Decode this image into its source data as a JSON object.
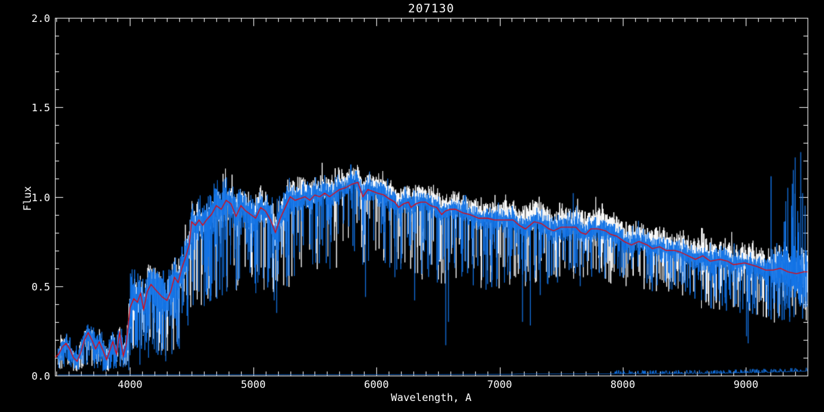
{
  "chart_data": {
    "type": "line",
    "title": "207130",
    "xlabel": "Wavelength, A",
    "ylabel": "Flux",
    "xlim": [
      3390,
      9500
    ],
    "ylim": [
      0.0,
      2.0
    ],
    "data_start": 3415,
    "x_ticks": [
      4000,
      5000,
      6000,
      7000,
      8000,
      9000
    ],
    "x_tick_labels": [
      "4000",
      "5000",
      "6000",
      "7000",
      "8000",
      "9000"
    ],
    "x_minor_step": 100,
    "y_ticks": [
      0.0,
      0.5,
      1.0,
      1.5,
      2.0
    ],
    "y_tick_labels": [
      "0.0",
      "0.5",
      "1.0",
      "1.5",
      "2.0"
    ],
    "y_minor_step": 0.1,
    "grid": false,
    "legend": null,
    "colors": {
      "background": "#000000",
      "axis": "#FFFFFF",
      "white_series": "#FFFFFF",
      "blue_series": "#1474E6",
      "red_series": "#EE0000"
    },
    "series_info": [
      {
        "key": "white_series",
        "style": "noisy spectrum",
        "color": "#FFFFFF"
      },
      {
        "key": "blue_series",
        "style": "noisy spectrum with deep absorption spikes",
        "color": "#1474E6"
      },
      {
        "key": "red_series",
        "style": "smooth fit through spectrum",
        "color": "#EE0000"
      },
      {
        "key": "error_series",
        "style": "near-zero error spectrum along bottom",
        "color": "#1474E6"
      }
    ],
    "noise_seed": 20713,
    "continuum": [
      [
        3390,
        0.1
      ],
      [
        3420,
        0.12
      ],
      [
        3450,
        0.16
      ],
      [
        3480,
        0.18
      ],
      [
        3510,
        0.15
      ],
      [
        3540,
        0.1
      ],
      [
        3570,
        0.08
      ],
      [
        3600,
        0.13
      ],
      [
        3630,
        0.2
      ],
      [
        3660,
        0.24
      ],
      [
        3690,
        0.2
      ],
      [
        3720,
        0.15
      ],
      [
        3750,
        0.19
      ],
      [
        3780,
        0.14
      ],
      [
        3810,
        0.09
      ],
      [
        3840,
        0.15
      ],
      [
        3860,
        0.19
      ],
      [
        3890,
        0.12
      ],
      [
        3915,
        0.24
      ],
      [
        3945,
        0.11
      ],
      [
        3970,
        0.18
      ],
      [
        4000,
        0.38
      ],
      [
        4030,
        0.43
      ],
      [
        4060,
        0.41
      ],
      [
        4085,
        0.46
      ],
      [
        4110,
        0.37
      ],
      [
        4140,
        0.47
      ],
      [
        4170,
        0.51
      ],
      [
        4220,
        0.47
      ],
      [
        4260,
        0.44
      ],
      [
        4300,
        0.42
      ],
      [
        4330,
        0.47
      ],
      [
        4360,
        0.55
      ],
      [
        4390,
        0.52
      ],
      [
        4420,
        0.6
      ],
      [
        4450,
        0.66
      ],
      [
        4480,
        0.73
      ],
      [
        4500,
        0.86
      ],
      [
        4530,
        0.84
      ],
      [
        4560,
        0.87
      ],
      [
        4590,
        0.84
      ],
      [
        4620,
        0.87
      ],
      [
        4660,
        0.9
      ],
      [
        4700,
        0.95
      ],
      [
        4740,
        0.93
      ],
      [
        4780,
        0.98
      ],
      [
        4820,
        0.96
      ],
      [
        4860,
        0.89
      ],
      [
        4900,
        0.95
      ],
      [
        4940,
        0.92
      ],
      [
        4980,
        0.9
      ],
      [
        5020,
        0.88
      ],
      [
        5060,
        0.94
      ],
      [
        5100,
        0.92
      ],
      [
        5140,
        0.87
      ],
      [
        5180,
        0.8
      ],
      [
        5220,
        0.88
      ],
      [
        5260,
        0.94
      ],
      [
        5300,
        1.0
      ],
      [
        5340,
        0.98
      ],
      [
        5380,
        0.99
      ],
      [
        5420,
        1.0
      ],
      [
        5460,
        0.98
      ],
      [
        5500,
        1.01
      ],
      [
        5540,
        1.0
      ],
      [
        5580,
        1.02
      ],
      [
        5620,
        1.0
      ],
      [
        5660,
        1.02
      ],
      [
        5700,
        1.04
      ],
      [
        5750,
        1.05
      ],
      [
        5800,
        1.07
      ],
      [
        5850,
        1.08
      ],
      [
        5890,
        1.0
      ],
      [
        5930,
        1.04
      ],
      [
        5970,
        1.03
      ],
      [
        6010,
        1.02
      ],
      [
        6060,
        1.01
      ],
      [
        6100,
        0.99
      ],
      [
        6150,
        0.97
      ],
      [
        6180,
        0.94
      ],
      [
        6220,
        0.96
      ],
      [
        6260,
        0.97
      ],
      [
        6280,
        0.94
      ],
      [
        6320,
        0.96
      ],
      [
        6360,
        0.97
      ],
      [
        6400,
        0.97
      ],
      [
        6440,
        0.95
      ],
      [
        6490,
        0.94
      ],
      [
        6530,
        0.9
      ],
      [
        6560,
        0.92
      ],
      [
        6600,
        0.93
      ],
      [
        6640,
        0.93
      ],
      [
        6700,
        0.91
      ],
      [
        6760,
        0.9
      ],
      [
        6830,
        0.88
      ],
      [
        6900,
        0.88
      ],
      [
        6960,
        0.87
      ],
      [
        7030,
        0.87
      ],
      [
        7110,
        0.87
      ],
      [
        7160,
        0.84
      ],
      [
        7210,
        0.82
      ],
      [
        7280,
        0.86
      ],
      [
        7340,
        0.85
      ],
      [
        7400,
        0.82
      ],
      [
        7440,
        0.81
      ],
      [
        7500,
        0.83
      ],
      [
        7560,
        0.83
      ],
      [
        7620,
        0.83
      ],
      [
        7660,
        0.8
      ],
      [
        7700,
        0.79
      ],
      [
        7740,
        0.82
      ],
      [
        7800,
        0.82
      ],
      [
        7860,
        0.81
      ],
      [
        7900,
        0.79
      ],
      [
        7950,
        0.78
      ],
      [
        8010,
        0.75
      ],
      [
        8070,
        0.73
      ],
      [
        8130,
        0.75
      ],
      [
        8200,
        0.73
      ],
      [
        8240,
        0.71
      ],
      [
        8300,
        0.72
      ],
      [
        8350,
        0.7
      ],
      [
        8420,
        0.7
      ],
      [
        8470,
        0.69
      ],
      [
        8530,
        0.67
      ],
      [
        8590,
        0.65
      ],
      [
        8650,
        0.67
      ],
      [
        8710,
        0.64
      ],
      [
        8790,
        0.65
      ],
      [
        8850,
        0.64
      ],
      [
        8900,
        0.62
      ],
      [
        8990,
        0.63
      ],
      [
        9090,
        0.61
      ],
      [
        9160,
        0.59
      ],
      [
        9220,
        0.59
      ],
      [
        9280,
        0.6
      ],
      [
        9340,
        0.58
      ],
      [
        9410,
        0.57
      ],
      [
        9470,
        0.58
      ],
      [
        9500,
        0.58
      ]
    ],
    "blue_down_spikes": [
      [
        3990,
        0.03
      ],
      [
        4080,
        0.06
      ],
      [
        4150,
        0.1
      ],
      [
        4290,
        0.08
      ],
      [
        4340,
        0.12
      ],
      [
        4400,
        0.15
      ],
      [
        4470,
        0.28
      ],
      [
        4760,
        0.55
      ],
      [
        4861,
        0.48
      ],
      [
        5170,
        0.42
      ],
      [
        5190,
        0.35
      ],
      [
        5270,
        0.55
      ],
      [
        5890,
        0.62
      ],
      [
        5912,
        0.44
      ],
      [
        6150,
        0.55
      ],
      [
        6310,
        0.42
      ],
      [
        6495,
        0.52
      ],
      [
        6563,
        0.17
      ],
      [
        6585,
        0.3
      ],
      [
        6700,
        0.58
      ],
      [
        6868,
        0.55
      ],
      [
        6890,
        0.48
      ],
      [
        7186,
        0.3
      ],
      [
        7250,
        0.28
      ],
      [
        7330,
        0.45
      ],
      [
        7470,
        0.52
      ],
      [
        7605,
        0.62
      ],
      [
        7655,
        0.5
      ],
      [
        8000,
        0.55
      ],
      [
        8230,
        0.52
      ],
      [
        8430,
        0.5
      ],
      [
        8545,
        0.45
      ],
      [
        8670,
        0.42
      ],
      [
        8780,
        0.48
      ],
      [
        8952,
        0.35
      ],
      [
        9005,
        0.22
      ],
      [
        9018,
        0.18
      ],
      [
        9065,
        0.4
      ],
      [
        9120,
        0.42
      ],
      [
        9355,
        0.3
      ]
    ],
    "blue_up_spikes": [
      [
        7598,
        1.02
      ],
      [
        7625,
        0.95
      ],
      [
        7648,
        0.9
      ],
      [
        9310,
        0.86
      ],
      [
        9340,
        1.05
      ],
      [
        9370,
        0.95
      ],
      [
        9385,
        1.15
      ],
      [
        9400,
        1.22
      ],
      [
        9420,
        0.92
      ],
      [
        9445,
        1.25
      ],
      [
        9460,
        1.02
      ],
      [
        9480,
        0.95
      ]
    ],
    "white_down_spikes": [
      [
        5995,
        0.7
      ],
      [
        6060,
        0.66
      ],
      [
        6120,
        0.63
      ],
      [
        6210,
        0.68
      ],
      [
        6290,
        0.66
      ],
      [
        6380,
        0.7
      ],
      [
        6450,
        0.62
      ],
      [
        6520,
        0.65
      ],
      [
        6610,
        0.68
      ],
      [
        6720,
        0.64
      ],
      [
        6790,
        0.6
      ],
      [
        6850,
        0.58
      ],
      [
        6930,
        0.62
      ],
      [
        7010,
        0.66
      ],
      [
        7130,
        0.55
      ],
      [
        7210,
        0.5
      ],
      [
        7290,
        0.52
      ],
      [
        7380,
        0.58
      ],
      [
        7460,
        0.55
      ],
      [
        7530,
        0.6
      ],
      [
        7600,
        0.58
      ],
      [
        7680,
        0.55
      ],
      [
        7760,
        0.6
      ],
      [
        7850,
        0.62
      ],
      [
        7930,
        0.58
      ],
      [
        8040,
        0.55
      ],
      [
        8130,
        0.58
      ],
      [
        8250,
        0.55
      ],
      [
        8350,
        0.57
      ],
      [
        8500,
        0.52
      ],
      [
        8650,
        0.5
      ],
      [
        8800,
        0.5
      ],
      [
        8930,
        0.48
      ],
      [
        9050,
        0.45
      ],
      [
        9180,
        0.47
      ],
      [
        9300,
        0.44
      ],
      [
        9420,
        0.46
      ]
    ],
    "noise_regions": [
      {
        "from": 3390,
        "to": 3700,
        "blue_amp": 0.055,
        "white_amp": 0.05,
        "blue_spike_p": 0.3,
        "white_spike_p": 0.22,
        "depth": [
          0.25,
          0.7
        ],
        "white_lift": 1.0
      },
      {
        "from": 3700,
        "to": 3990,
        "blue_amp": 0.075,
        "white_amp": 0.06,
        "blue_spike_p": 0.35,
        "white_spike_p": 0.25,
        "depth": [
          0.2,
          0.7
        ],
        "white_lift": 1.0
      },
      {
        "from": 3990,
        "to": 4400,
        "blue_amp": 0.14,
        "white_amp": 0.11,
        "blue_spike_p": 0.3,
        "white_spike_p": 0.22,
        "depth": [
          0.25,
          0.7
        ],
        "white_lift": 1.0
      },
      {
        "from": 4400,
        "to": 4800,
        "blue_amp": 0.12,
        "white_amp": 0.1,
        "blue_spike_p": 0.28,
        "white_spike_p": 0.2,
        "depth": [
          0.45,
          0.8
        ],
        "white_lift": 1.0
      },
      {
        "from": 4800,
        "to": 5300,
        "blue_amp": 0.1,
        "white_amp": 0.09,
        "blue_spike_p": 0.25,
        "white_spike_p": 0.18,
        "depth": [
          0.5,
          0.85
        ],
        "white_lift": 1.02
      },
      {
        "from": 5300,
        "to": 5700,
        "blue_amp": 0.085,
        "white_amp": 0.08,
        "blue_spike_p": 0.2,
        "white_spike_p": 0.15,
        "depth": [
          0.55,
          0.9
        ],
        "white_lift": 1.03
      },
      {
        "from": 5700,
        "to": 6300,
        "blue_amp": 0.062,
        "white_amp": 0.06,
        "blue_spike_p": 0.18,
        "white_spike_p": 0.15,
        "depth": [
          0.6,
          0.92
        ],
        "white_lift": 1.04
      },
      {
        "from": 6300,
        "to": 7100,
        "blue_amp": 0.058,
        "white_amp": 0.068,
        "blue_spike_p": 0.22,
        "white_spike_p": 0.2,
        "depth": [
          0.55,
          0.9
        ],
        "white_lift": 1.035
      },
      {
        "from": 7100,
        "to": 7700,
        "blue_amp": 0.07,
        "white_amp": 0.08,
        "blue_spike_p": 0.22,
        "white_spike_p": 0.24,
        "depth": [
          0.6,
          0.9
        ],
        "white_lift": 1.05
      },
      {
        "from": 7700,
        "to": 8600,
        "blue_amp": 0.062,
        "white_amp": 0.075,
        "blue_spike_p": 0.2,
        "white_spike_p": 0.22,
        "depth": [
          0.65,
          0.92
        ],
        "white_lift": 1.05
      },
      {
        "from": 8600,
        "to": 9200,
        "blue_amp": 0.068,
        "white_amp": 0.085,
        "blue_spike_p": 0.25,
        "white_spike_p": 0.24,
        "depth": [
          0.55,
          0.9
        ],
        "white_lift": 1.05
      },
      {
        "from": 9200,
        "to": 9501,
        "blue_amp": 0.13,
        "white_amp": 0.1,
        "blue_spike_p": 0.28,
        "white_spike_p": 0.22,
        "depth": [
          0.5,
          0.9
        ],
        "white_lift": 1.04,
        "up_p": 0.12,
        "up_amp": 0.45
      }
    ],
    "error_spectrum": [
      [
        3390,
        0.004
      ],
      [
        5000,
        0.005
      ],
      [
        6500,
        0.006
      ],
      [
        7100,
        0.007
      ],
      [
        7150,
        0.009
      ],
      [
        8000,
        0.01
      ],
      [
        8500,
        0.011
      ],
      [
        8800,
        0.013
      ],
      [
        9000,
        0.016
      ],
      [
        9200,
        0.018
      ],
      [
        9350,
        0.022
      ],
      [
        9500,
        0.025
      ]
    ],
    "error_noise": {
      "from": 7900,
      "p": 0.3,
      "max_add": 0.02
    }
  }
}
